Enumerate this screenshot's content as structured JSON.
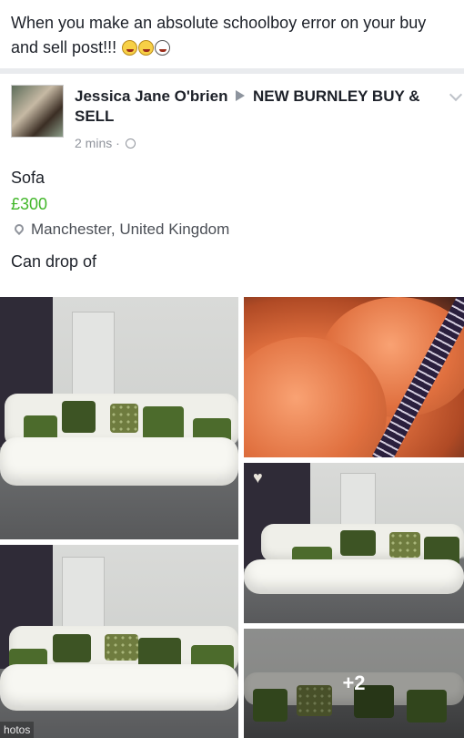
{
  "caption": {
    "text": "When you make an absolute schoolboy error on your buy and sell post!!!",
    "emojis": [
      "face-with-tears-of-joy-icon",
      "face-with-tears-of-joy-icon",
      "face-screaming-icon"
    ]
  },
  "post": {
    "author": "Jessica Jane O'brien",
    "group": "NEW BURNLEY BUY & SELL",
    "time": "2 mins",
    "separator": "·",
    "item": {
      "title": "Sofa",
      "price": "£300",
      "location": "Manchester, United Kingdom",
      "description": "Can drop of"
    }
  },
  "photos": {
    "more_count": "+2",
    "tag": "hotos"
  },
  "colors": {
    "price": "#42b72a",
    "meta": "#90949c",
    "divider": "#e9ebee"
  }
}
